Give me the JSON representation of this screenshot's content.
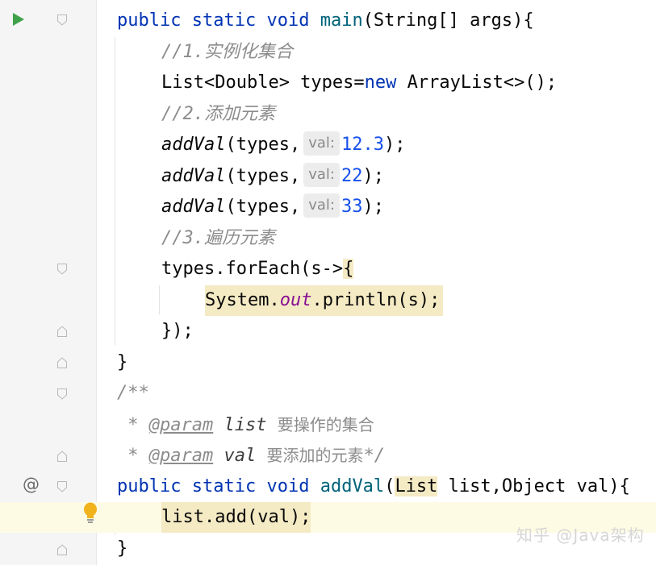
{
  "editor": {
    "lines": [
      {
        "id": "l1"
      },
      {
        "comment": "//1.实例化集合"
      },
      {
        "kw": "new"
      },
      {
        "comment": "//2.添加元素"
      },
      {
        "call": "addVal",
        "arg": "types,",
        "hint": "val:",
        "value": "12.3",
        "end": ");"
      },
      {
        "call": "addVal",
        "arg": "types,",
        "hint": "val:",
        "value": "22",
        "end": ");"
      },
      {
        "call": "addVal",
        "arg": "types,",
        "hint": "val:",
        "value": "33",
        "end": ");"
      },
      {
        "comment": "//3.遍历元素"
      }
    ],
    "main_signature": {
      "public": "public",
      "static": "static",
      "void": "void",
      "name": "main",
      "params": "(String[] args){"
    },
    "list_decl": {
      "type": "List<Double> types=",
      "new_kw": "new",
      "rest": " ArrayList<>();"
    },
    "foreach": {
      "head": "types.forEach(s->",
      "brace": "{",
      "body_a": "System.",
      "body_out": "out",
      "body_b": ".println(s);",
      "close": "});"
    },
    "close_brace": "}",
    "javadoc": {
      "open": "/**",
      "param1_star": " * ",
      "param1_tag": "@param",
      "param1_name": " list ",
      "param1_desc": "要操作的集合",
      "param2_star": " * ",
      "param2_tag": "@param",
      "param2_name": " val ",
      "param2_desc": "要添加的元素",
      "param2_end": "*/"
    },
    "addval_signature": {
      "public": "public",
      "static": "static",
      "void": "void",
      "name": "addVal",
      "lparen": "(",
      "list_type": "List",
      "rest": " list,Object val){"
    },
    "addval_body": "list.add(val);",
    "final_brace": "}"
  },
  "gutter": {
    "run_icon": "run-triangle-icon",
    "override_icon": "@",
    "intention_icon": "lightbulb-icon"
  },
  "watermark": "知乎 @Java架构",
  "colors": {
    "keyword": "#0033b3",
    "method": "#00627a",
    "number": "#1750eb",
    "comment": "#8c8c8c",
    "field": "#871094",
    "highlight": "#fefbe4",
    "brace_match": "#f4eac4"
  }
}
